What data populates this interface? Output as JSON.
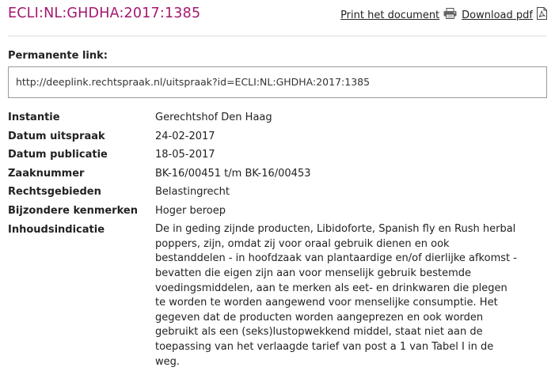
{
  "header": {
    "ecli": "ECLI:NL:GHDHA:2017:1385",
    "print_label": "Print het document",
    "download_label": "Download pdf",
    "print_icon": "printer-icon",
    "download_icon": "pdf-icon",
    "accent_color": "#a4176e"
  },
  "permalink": {
    "label": "Permanente link:",
    "url": "http://deeplink.rechtspraak.nl/uitspraak?id=ECLI:NL:GHDHA:2017:1385"
  },
  "meta": [
    {
      "key": "Instantie",
      "value": "Gerechtshof Den Haag"
    },
    {
      "key": "Datum uitspraak",
      "value": "24-02-2017"
    },
    {
      "key": "Datum publicatie",
      "value": "18-05-2017"
    },
    {
      "key": "Zaaknummer",
      "value": "BK-16/00451 t/m BK-16/00453"
    },
    {
      "key": "Rechtsgebieden",
      "value": "Belastingrecht"
    },
    {
      "key": "Bijzondere kenmerken",
      "value": "Hoger beroep"
    },
    {
      "key": "Inhoudsindicatie",
      "value": "De in geding zijnde producten, Libidoforte, Spanish fly en Rush herbal poppers, zijn, omdat zij voor oraal gebruik dienen en ook bestanddelen - in hoofdzaak van plantaardige en/of dierlijke afkomst - bevatten die eigen zijn aan voor menselijk gebruik bestemde voedingsmiddelen, aan te merken als eet- en drinkwaren die plegen te worden te worden aangewend voor menselijke consumptie. Het gegeven dat de producten worden aangeprezen en ook worden gebruikt als een (seks)lustopwekkend middel, staat niet aan de toepassing van het verlaagde tarief van post a 1 van Tabel I in de weg."
    }
  ]
}
